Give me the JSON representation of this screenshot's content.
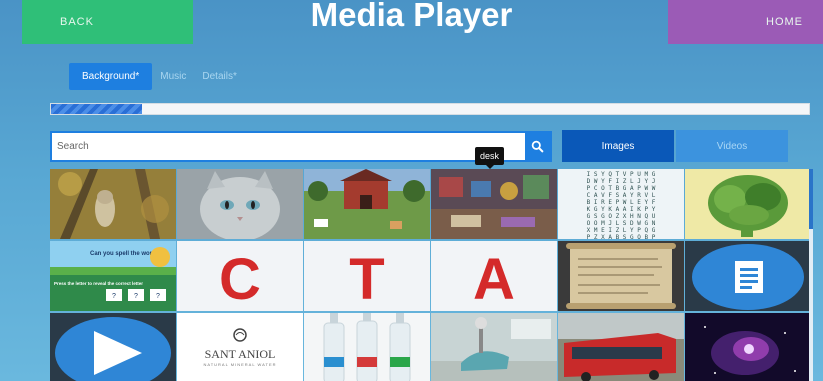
{
  "header": {
    "back_label": "BACK",
    "title": "Media Player",
    "home_label": "HOME"
  },
  "tabs": [
    {
      "label": "Background*",
      "active": true
    },
    {
      "label": "Music",
      "active": false
    },
    {
      "label": "Details*",
      "active": false
    }
  ],
  "progress": {
    "fraction": 0.12
  },
  "search": {
    "placeholder": "Search",
    "value": "",
    "icon": "search-icon"
  },
  "media_type": {
    "images_label": "Images",
    "videos_label": "Videos",
    "selected": "Images"
  },
  "tooltip": {
    "text": "desk"
  },
  "tiles": [
    {
      "name": "owl-in-tree",
      "type": "image"
    },
    {
      "name": "gray-cat",
      "type": "image"
    },
    {
      "name": "farm-scene",
      "type": "image"
    },
    {
      "name": "cluttered-desk",
      "type": "image"
    },
    {
      "name": "word-search",
      "type": "image",
      "lines": [
        "ISYQTVPUMG",
        "DWYFIZLJYJ",
        "PCOTBGAPWW",
        "CAVFSAYRVL",
        "BIREPWLEYF",
        "KGYKAAIKPY",
        "GSGOZXHNQU",
        "OOMJLSDWGN",
        "XMEIZLYPQG",
        "PZXABSGQBP"
      ]
    },
    {
      "name": "green-brain",
      "type": "image"
    },
    {
      "name": "spell-the-word-game",
      "type": "image",
      "text": "Can you spell the word",
      "subtext": "Press the letter to reveal the correct letter",
      "key": "?"
    },
    {
      "name": "letter-c",
      "type": "image",
      "letter": "C"
    },
    {
      "name": "letter-t",
      "type": "image",
      "letter": "T"
    },
    {
      "name": "letter-a",
      "type": "image",
      "letter": "A"
    },
    {
      "name": "parchment-scroll",
      "type": "image"
    },
    {
      "name": "document-icon-tile",
      "type": "image",
      "icon": "document-icon"
    },
    {
      "name": "play-icon-tile",
      "type": "image",
      "icon": "play-icon"
    },
    {
      "name": "sant-aniol-logo",
      "type": "image",
      "text": "SANT ANIOL",
      "subtext": "NATURAL MINERAL WATER"
    },
    {
      "name": "water-bottles",
      "type": "image"
    },
    {
      "name": "dental-office",
      "type": "image"
    },
    {
      "name": "red-bus",
      "type": "image"
    },
    {
      "name": "space-nebula",
      "type": "image"
    }
  ],
  "colors": {
    "back": "#2fbf78",
    "home": "#9b5bb6",
    "accent": "#1e7fe0",
    "images_active": "#0a58b8",
    "videos_inactive": "#3c93de"
  }
}
